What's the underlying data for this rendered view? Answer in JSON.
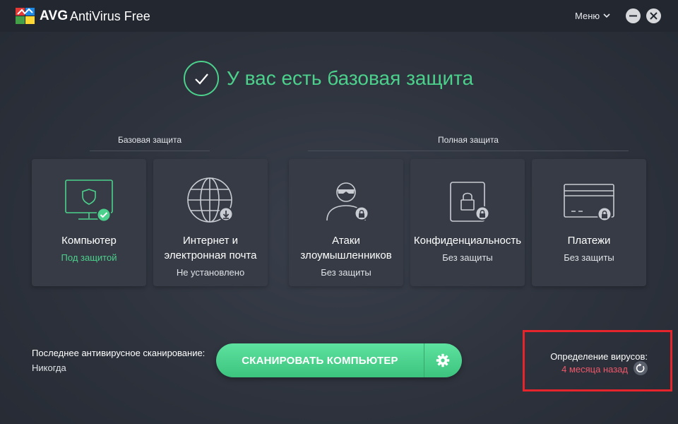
{
  "app": {
    "brand": "AVG",
    "product": "AntiVirus Free",
    "menu_label": "Меню"
  },
  "status": {
    "text": "У вас есть базовая защита",
    "color": "#4cd18c"
  },
  "groups": {
    "basic": "Базовая защита",
    "full": "Полная защита"
  },
  "cards": [
    {
      "title": "Компьютер",
      "status": "Под защитой",
      "icon": "monitor-shield-icon",
      "badge": "check-badge-icon"
    },
    {
      "title": "Интернет и электронная почта",
      "status": "Не установлено",
      "icon": "globe-icon",
      "badge": "download-badge-icon"
    },
    {
      "title": "Атаки злоумышленников",
      "status": "Без защиты",
      "icon": "hacker-icon",
      "badge": "lock-badge-icon"
    },
    {
      "title": "Конфиденциальность",
      "status": "Без защиты",
      "icon": "privacy-lock-icon",
      "badge": "lock-badge-icon"
    },
    {
      "title": "Платежи",
      "status": "Без защиты",
      "icon": "credit-card-icon",
      "badge": "lock-badge-icon"
    }
  ],
  "scan": {
    "last_scan_label": "Последнее антивирусное сканирование:",
    "last_scan_value": "Никогда",
    "button_label": "СКАНИРОВАТЬ КОМПЬЮТЕР"
  },
  "definitions": {
    "label": "Определение вирусов:",
    "value": "4 месяца назад",
    "value_color": "#f0576a"
  }
}
